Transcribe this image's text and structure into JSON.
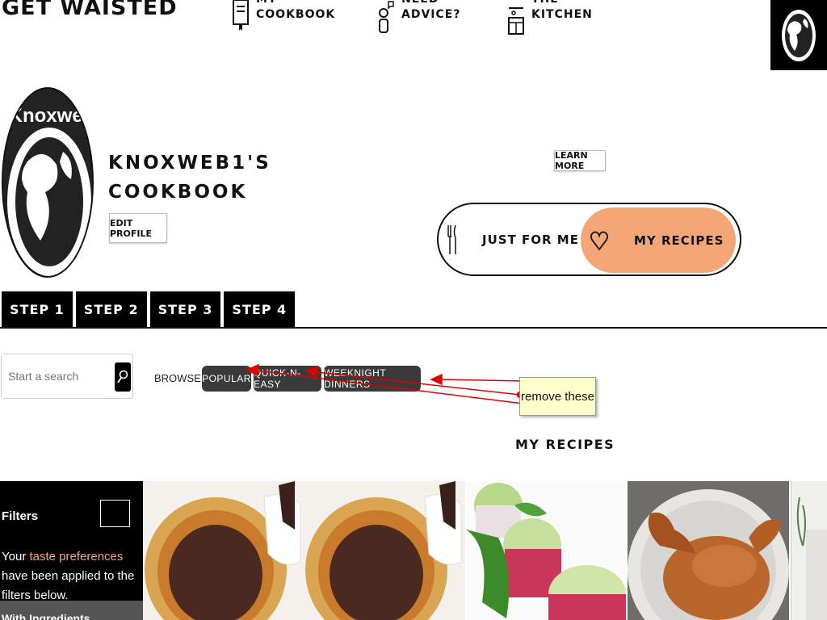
{
  "brand": "GET WAISTED",
  "nav": {
    "cookbook": "MY COOKBOOK",
    "advice": "NEED ADVICE?",
    "kitchen": "THE KITCHEN"
  },
  "profile": {
    "avatar_text": "Knoxweb",
    "name": "KNOXWEB1'S COOKBOOK",
    "edit_label": "EDIT PROFILE",
    "learn_more_label": "LEARN MORE"
  },
  "toggle": {
    "left_label": "JUST FOR ME",
    "right_label": "MY RECIPES"
  },
  "steps": [
    "STEP 1",
    "STEP 2",
    "STEP 3",
    "STEP 4"
  ],
  "search": {
    "placeholder": "Start a search"
  },
  "browse": {
    "label": "BROWSE:",
    "pills": [
      "POPULAR",
      "QUICK-N-EASY",
      "WEEKNIGHT DINNERS"
    ]
  },
  "annotation": {
    "text": "remove these"
  },
  "section_title": "MY RECIPES",
  "filters": {
    "title": "Filters",
    "text_before": "Your ",
    "link": "taste preferences",
    "text_after": " have been applied to the filters below.",
    "subheader": "With Ingredients"
  },
  "colors": {
    "accent": "#f5a677",
    "black": "#000000",
    "pill": "#3a3a3a",
    "annotation_arrow": "#e00000",
    "note_bg": "#ffffcc"
  }
}
